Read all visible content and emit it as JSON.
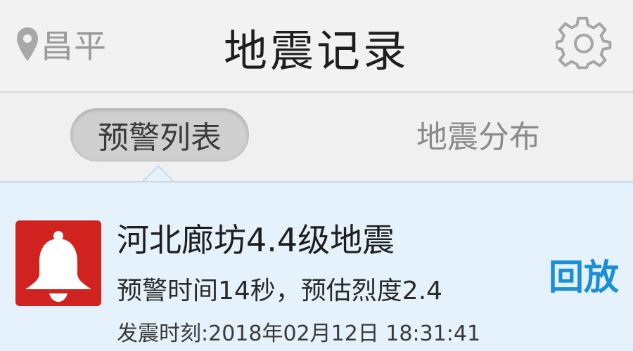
{
  "header": {
    "location": "昌平",
    "title": "地震记录",
    "location_icon": "location-pin-icon",
    "settings_icon": "gear-icon"
  },
  "tabs": [
    {
      "label": "预警列表",
      "active": true
    },
    {
      "label": "地震分布",
      "active": false
    }
  ],
  "records": [
    {
      "icon": "bell-icon",
      "title": "河北廊坊4.4级地震",
      "warning": "预警时间14秒，预估烈度2.4",
      "time": "发震时刻:2018年02月12日 18:31:41",
      "action": "回放"
    }
  ],
  "colors": {
    "accent": "#1a8fd6",
    "alert": "#d0221f",
    "list_background": "#e5f1fb"
  }
}
